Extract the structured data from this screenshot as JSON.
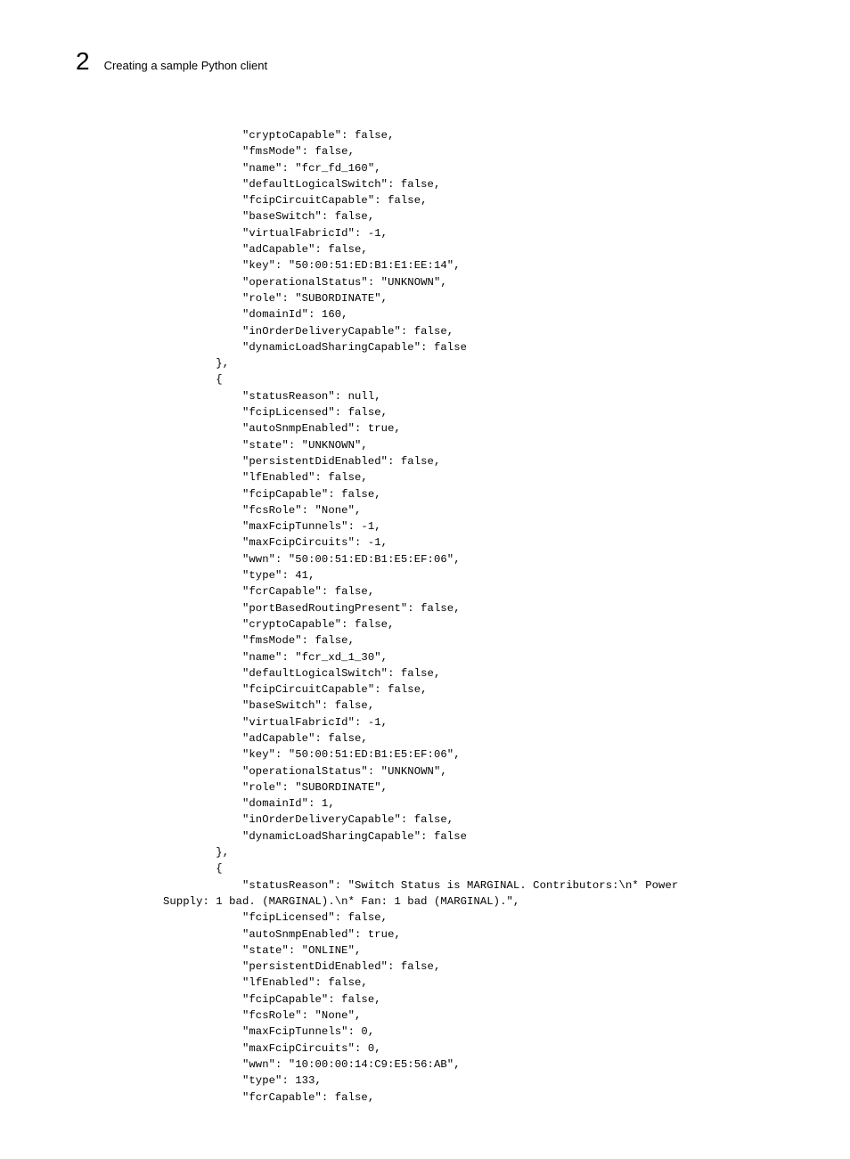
{
  "header": {
    "chapter_number": "2",
    "title": "Creating a sample Python client"
  },
  "code": "            \"cryptoCapable\": false,\n            \"fmsMode\": false,\n            \"name\": \"fcr_fd_160\",\n            \"defaultLogicalSwitch\": false,\n            \"fcipCircuitCapable\": false,\n            \"baseSwitch\": false,\n            \"virtualFabricId\": -1,\n            \"adCapable\": false,\n            \"key\": \"50:00:51:ED:B1:E1:EE:14\",\n            \"operationalStatus\": \"UNKNOWN\",\n            \"role\": \"SUBORDINATE\",\n            \"domainId\": 160,\n            \"inOrderDeliveryCapable\": false,\n            \"dynamicLoadSharingCapable\": false\n        },\n        {\n            \"statusReason\": null,\n            \"fcipLicensed\": false,\n            \"autoSnmpEnabled\": true,\n            \"state\": \"UNKNOWN\",\n            \"persistentDidEnabled\": false,\n            \"lfEnabled\": false,\n            \"fcipCapable\": false,\n            \"fcsRole\": \"None\",\n            \"maxFcipTunnels\": -1,\n            \"maxFcipCircuits\": -1,\n            \"wwn\": \"50:00:51:ED:B1:E5:EF:06\",\n            \"type\": 41,\n            \"fcrCapable\": false,\n            \"portBasedRoutingPresent\": false,\n            \"cryptoCapable\": false,\n            \"fmsMode\": false,\n            \"name\": \"fcr_xd_1_30\",\n            \"defaultLogicalSwitch\": false,\n            \"fcipCircuitCapable\": false,\n            \"baseSwitch\": false,\n            \"virtualFabricId\": -1,\n            \"adCapable\": false,\n            \"key\": \"50:00:51:ED:B1:E5:EF:06\",\n            \"operationalStatus\": \"UNKNOWN\",\n            \"role\": \"SUBORDINATE\",\n            \"domainId\": 1,\n            \"inOrderDeliveryCapable\": false,\n            \"dynamicLoadSharingCapable\": false\n        },\n        {\n            \"statusReason\": \"Switch Status is MARGINAL. Contributors:\\n* Power \nSupply: 1 bad. (MARGINAL).\\n* Fan: 1 bad (MARGINAL).\",\n            \"fcipLicensed\": false,\n            \"autoSnmpEnabled\": true,\n            \"state\": \"ONLINE\",\n            \"persistentDidEnabled\": false,\n            \"lfEnabled\": false,\n            \"fcipCapable\": false,\n            \"fcsRole\": \"None\",\n            \"maxFcipTunnels\": 0,\n            \"maxFcipCircuits\": 0,\n            \"wwn\": \"10:00:00:14:C9:E5:56:AB\",\n            \"type\": 133,\n            \"fcrCapable\": false,"
}
